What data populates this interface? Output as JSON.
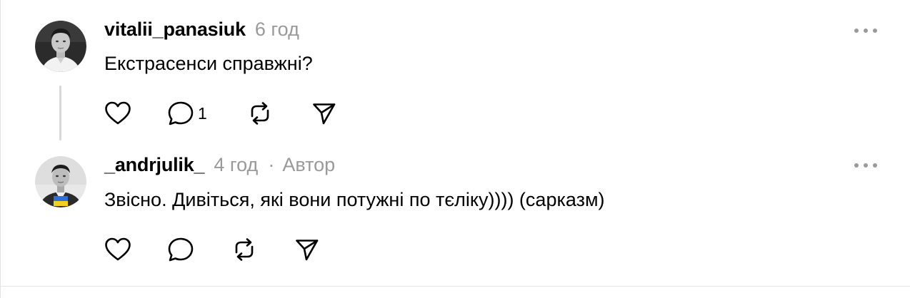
{
  "comments": [
    {
      "username": "vitalii_panasiuk",
      "time": "6 год",
      "text": "Екстрасенси справжні?",
      "reply_count": "1"
    },
    {
      "username": "_andrjulik_",
      "time": "4 год",
      "separator": "·",
      "author_badge": "Автор",
      "text": "Звісно. Дивіться, які вони потужні по тєліку)))) (сарказм)"
    }
  ],
  "icons": {
    "like": "heart-icon",
    "reply": "comment-bubble-icon",
    "repost": "repost-icon",
    "share": "send-icon",
    "more": "more-dots-icon"
  },
  "colors": {
    "text": "#000000",
    "muted": "#9a9a9a",
    "thread_line": "#d9d9d9",
    "flag_blue": "#2f6fd6",
    "flag_yellow": "#f5cf1d"
  }
}
